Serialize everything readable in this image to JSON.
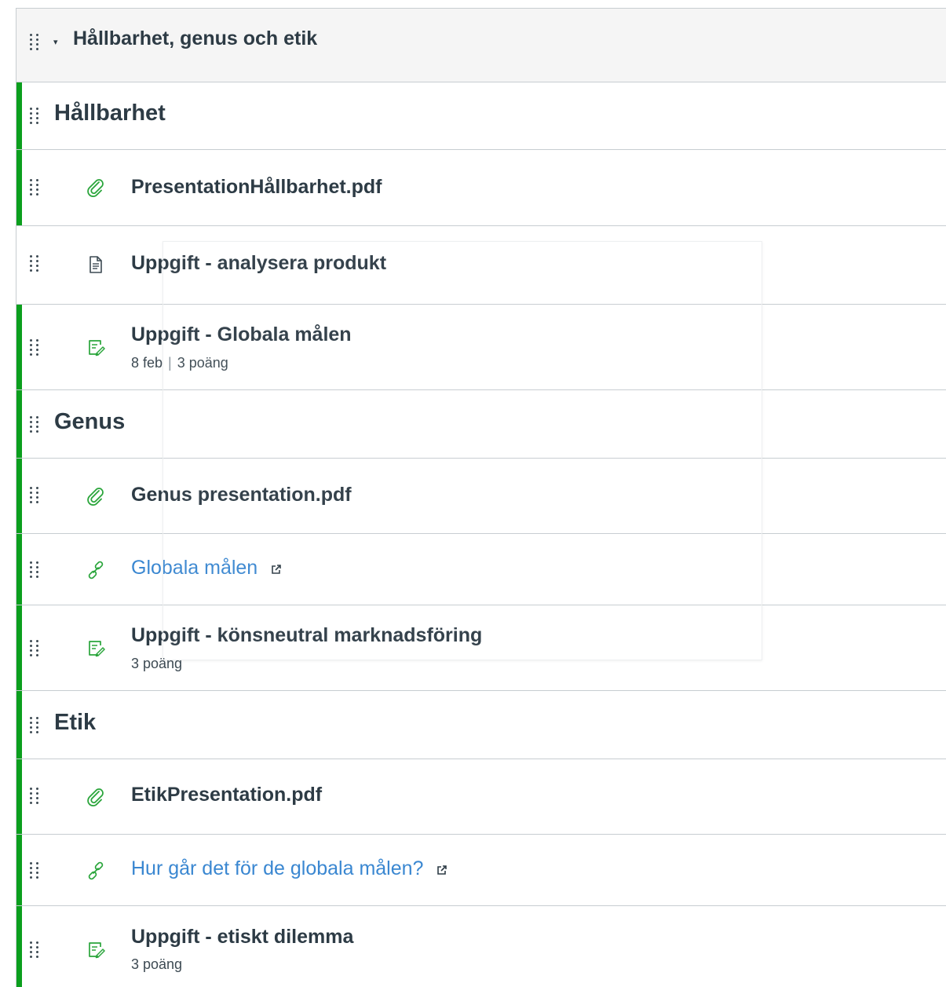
{
  "module": {
    "title": "Hållbarhet, genus och etik",
    "caret": "▾"
  },
  "items": [
    {
      "type": "subheader",
      "label": "Hållbarhet",
      "published": true
    },
    {
      "type": "attachment",
      "icon": "paperclip-icon",
      "label": "PresentationHållbarhet.pdf",
      "published": true
    },
    {
      "type": "page",
      "icon": "document-icon",
      "label": "Uppgift - analysera produkt",
      "published": false
    },
    {
      "type": "assignment",
      "icon": "assignment-icon",
      "label": "Uppgift - Globala målen",
      "due": "8 feb",
      "points": "3 poäng",
      "published": true
    },
    {
      "type": "subheader",
      "label": "Genus",
      "published": true
    },
    {
      "type": "attachment",
      "icon": "paperclip-icon",
      "label": "Genus presentation.pdf",
      "published": true
    },
    {
      "type": "external_link",
      "icon": "link-icon",
      "label": "Globala målen",
      "published": true
    },
    {
      "type": "assignment",
      "icon": "assignment-icon",
      "label": "Uppgift - könsneutral marknadsföring",
      "points": "3 poäng",
      "published": true
    },
    {
      "type": "subheader",
      "label": "Etik",
      "published": true
    },
    {
      "type": "attachment",
      "icon": "paperclip-icon",
      "label": "EtikPresentation.pdf",
      "published": true
    },
    {
      "type": "external_link",
      "icon": "link-icon",
      "label": "Hur går det för de globala målen?",
      "published": true
    },
    {
      "type": "assignment",
      "icon": "assignment-icon",
      "label": "Uppgift - etiskt dilemma",
      "points": "3 poäng",
      "published": true
    }
  ],
  "meta_separator": "|",
  "colors": {
    "published_bar": "#0b9f1d",
    "icon_green": "#2aa53b",
    "link_blue": "#3a87d1",
    "text": "#2d3b45",
    "header_bg": "#f5f5f5",
    "divider": "#c7cdd1"
  }
}
